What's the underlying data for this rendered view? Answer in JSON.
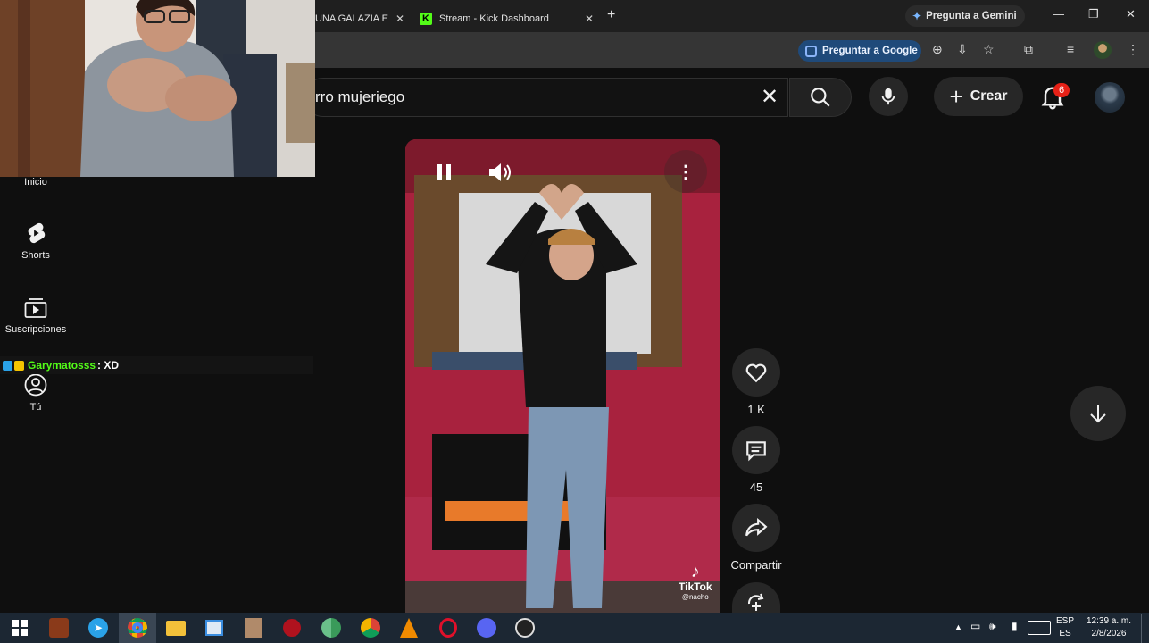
{
  "browser": {
    "tabs": [
      {
        "label": "UNA GALAZIA E",
        "close": "✕"
      },
      {
        "label": "Stream - Kick Dashboard",
        "close": "✕",
        "icon": "kick-icon"
      }
    ],
    "new_tab": "+",
    "gemini_label": "Pregunta a Gemini",
    "ask_google_label": "Preguntar a Google"
  },
  "youtube": {
    "search_query": "rro mujeriego",
    "create_label": "Crear",
    "notifications_count": "6",
    "sidebar": [
      {
        "label": "Inicio",
        "icon": "home-icon"
      },
      {
        "label": "Shorts",
        "icon": "shorts-icon"
      },
      {
        "label": "Suscripciones",
        "icon": "subscriptions-icon"
      },
      {
        "label": "Tú",
        "icon": "you-icon"
      }
    ],
    "short": {
      "likes": "1 K",
      "comments": "45",
      "share_label": "Compartir",
      "watermark_brand": "TikTok",
      "watermark_handle": "@nacho"
    }
  },
  "chat": {
    "user": "Garymatosss",
    "message": ": XD"
  },
  "taskbar": {
    "lang_top": "ESP",
    "lang_bottom": "ES",
    "time": "12:39 a. m.",
    "date": "2/8/2026"
  },
  "colors": {
    "kick_green": "#53fc18",
    "notif_red": "#e62117",
    "bg": "#0f0f0f"
  }
}
